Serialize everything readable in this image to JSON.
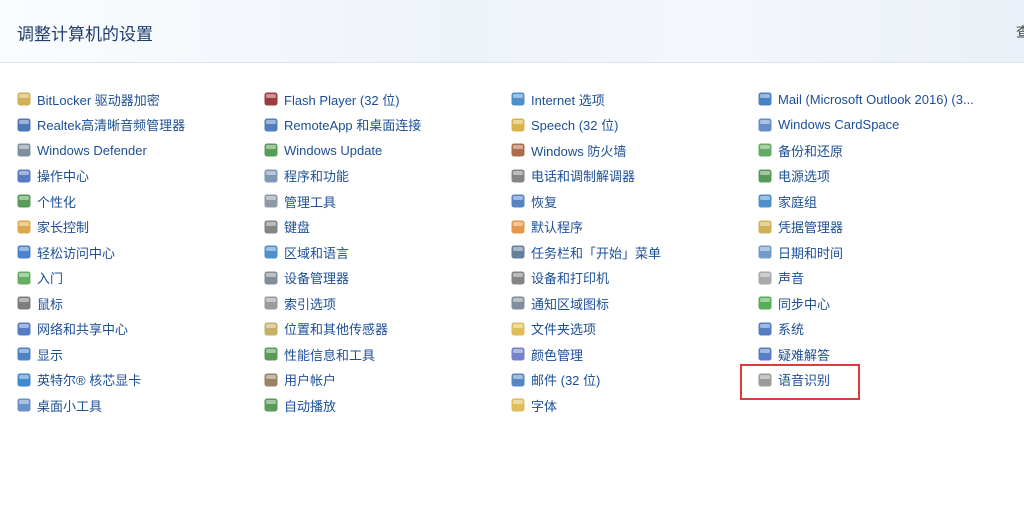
{
  "header": {
    "title": "调整计算机的设置",
    "edge_text": "查"
  },
  "columns": [
    {
      "items": [
        {
          "label": "BitLocker 驱动器加密",
          "icon": "key-icon",
          "color": "#c8a13a"
        },
        {
          "label": "Realtek高清晰音频管理器",
          "icon": "audio-manager-icon",
          "color": "#2f5fa8"
        },
        {
          "label": "Windows Defender",
          "icon": "defender-icon",
          "color": "#6b7b8c"
        },
        {
          "label": "操作中心",
          "icon": "flag-icon",
          "color": "#3a64b6"
        },
        {
          "label": "个性化",
          "icon": "personalize-icon",
          "color": "#3b8a3a"
        },
        {
          "label": "家长控制",
          "icon": "parental-icon",
          "color": "#d39a2b"
        },
        {
          "label": "轻松访问中心",
          "icon": "accessibility-icon",
          "color": "#2c6bc4"
        },
        {
          "label": "入门",
          "icon": "getting-started-icon",
          "color": "#4aa04a"
        },
        {
          "label": "鼠标",
          "icon": "mouse-icon",
          "color": "#666666"
        },
        {
          "label": "网络和共享中心",
          "icon": "network-icon",
          "color": "#3a67b8"
        },
        {
          "label": "显示",
          "icon": "display-icon",
          "color": "#2f6fb8"
        },
        {
          "label": "英特尔® 核芯显卡",
          "icon": "intel-graphics-icon",
          "color": "#1f75c9"
        },
        {
          "label": "桌面小工具",
          "icon": "gadgets-icon",
          "color": "#4d7fbf"
        }
      ]
    },
    {
      "items": [
        {
          "label": "Flash Player (32 位)",
          "icon": "flash-icon",
          "color": "#8b1a1a"
        },
        {
          "label": "RemoteApp 和桌面连接",
          "icon": "remoteapp-icon",
          "color": "#3367b0"
        },
        {
          "label": "Windows Update",
          "icon": "windows-update-icon",
          "color": "#3c8a3c"
        },
        {
          "label": "程序和功能",
          "icon": "programs-icon",
          "color": "#6b86a8"
        },
        {
          "label": "管理工具",
          "icon": "admin-tools-icon",
          "color": "#7a8796"
        },
        {
          "label": "键盘",
          "icon": "keyboard-icon",
          "color": "#707070"
        },
        {
          "label": "区域和语言",
          "icon": "globe-icon",
          "color": "#2f7dc0"
        },
        {
          "label": "设备管理器",
          "icon": "device-manager-icon",
          "color": "#6e7a86"
        },
        {
          "label": "索引选项",
          "icon": "index-icon",
          "color": "#8a8a8a"
        },
        {
          "label": "位置和其他传感器",
          "icon": "sensor-icon",
          "color": "#b9a14a"
        },
        {
          "label": "性能信息和工具",
          "icon": "performance-icon",
          "color": "#3a8a3a"
        },
        {
          "label": "用户帐户",
          "icon": "user-accounts-icon",
          "color": "#8a6b4a"
        },
        {
          "label": "自动播放",
          "icon": "autoplay-icon",
          "color": "#3c8a3c"
        }
      ]
    },
    {
      "items": [
        {
          "label": "Internet 选项",
          "icon": "internet-icon",
          "color": "#2f7dc0"
        },
        {
          "label": "Speech (32 位)",
          "icon": "speech-icon",
          "color": "#d4a72c"
        },
        {
          "label": "Windows 防火墙",
          "icon": "firewall-icon",
          "color": "#a0522d"
        },
        {
          "label": "电话和调制解调器",
          "icon": "phone-icon",
          "color": "#707070"
        },
        {
          "label": "恢复",
          "icon": "recovery-icon",
          "color": "#3b6fb6"
        },
        {
          "label": "默认程序",
          "icon": "default-programs-icon",
          "color": "#e0862a"
        },
        {
          "label": "任务栏和「开始」菜单",
          "icon": "taskbar-icon",
          "color": "#4a6a8a"
        },
        {
          "label": "设备和打印机",
          "icon": "printer-icon",
          "color": "#707070"
        },
        {
          "label": "通知区域图标",
          "icon": "notification-icon",
          "color": "#6a7a8a"
        },
        {
          "label": "文件夹选项",
          "icon": "folder-icon",
          "color": "#d9b13a"
        },
        {
          "label": "颜色管理",
          "icon": "color-management-icon",
          "color": "#5b6cc0"
        },
        {
          "label": "邮件 (32 位)",
          "icon": "mail-icon",
          "color": "#3a72b8"
        },
        {
          "label": "字体",
          "icon": "font-icon",
          "color": "#d9b13a"
        }
      ]
    },
    {
      "items": [
        {
          "label": "Mail (Microsoft Outlook 2016) (3...",
          "icon": "outlook-icon",
          "color": "#2a6bb8"
        },
        {
          "label": "Windows CardSpace",
          "icon": "cardspace-icon",
          "color": "#4a7ac0"
        },
        {
          "label": "备份和还原",
          "icon": "backup-icon",
          "color": "#4a9a4a"
        },
        {
          "label": "电源选项",
          "icon": "power-icon",
          "color": "#3a8a3a"
        },
        {
          "label": "家庭组",
          "icon": "homegroup-icon",
          "color": "#2f7dc0"
        },
        {
          "label": "凭据管理器",
          "icon": "credential-icon",
          "color": "#c9a23a"
        },
        {
          "label": "日期和时间",
          "icon": "clock-icon",
          "color": "#5a8ac0"
        },
        {
          "label": "声音",
          "icon": "sound-icon",
          "color": "#9a9a9a"
        },
        {
          "label": "同步中心",
          "icon": "sync-icon",
          "color": "#3aa03a"
        },
        {
          "label": "系统",
          "icon": "system-icon",
          "color": "#3a67b8"
        },
        {
          "label": "疑难解答",
          "icon": "troubleshoot-icon",
          "color": "#3a67b8"
        },
        {
          "label": "语音识别",
          "icon": "microphone-icon",
          "color": "#8a8a8a"
        }
      ]
    }
  ],
  "highlight": {
    "label": "语音识别",
    "color": "#e0393e"
  }
}
